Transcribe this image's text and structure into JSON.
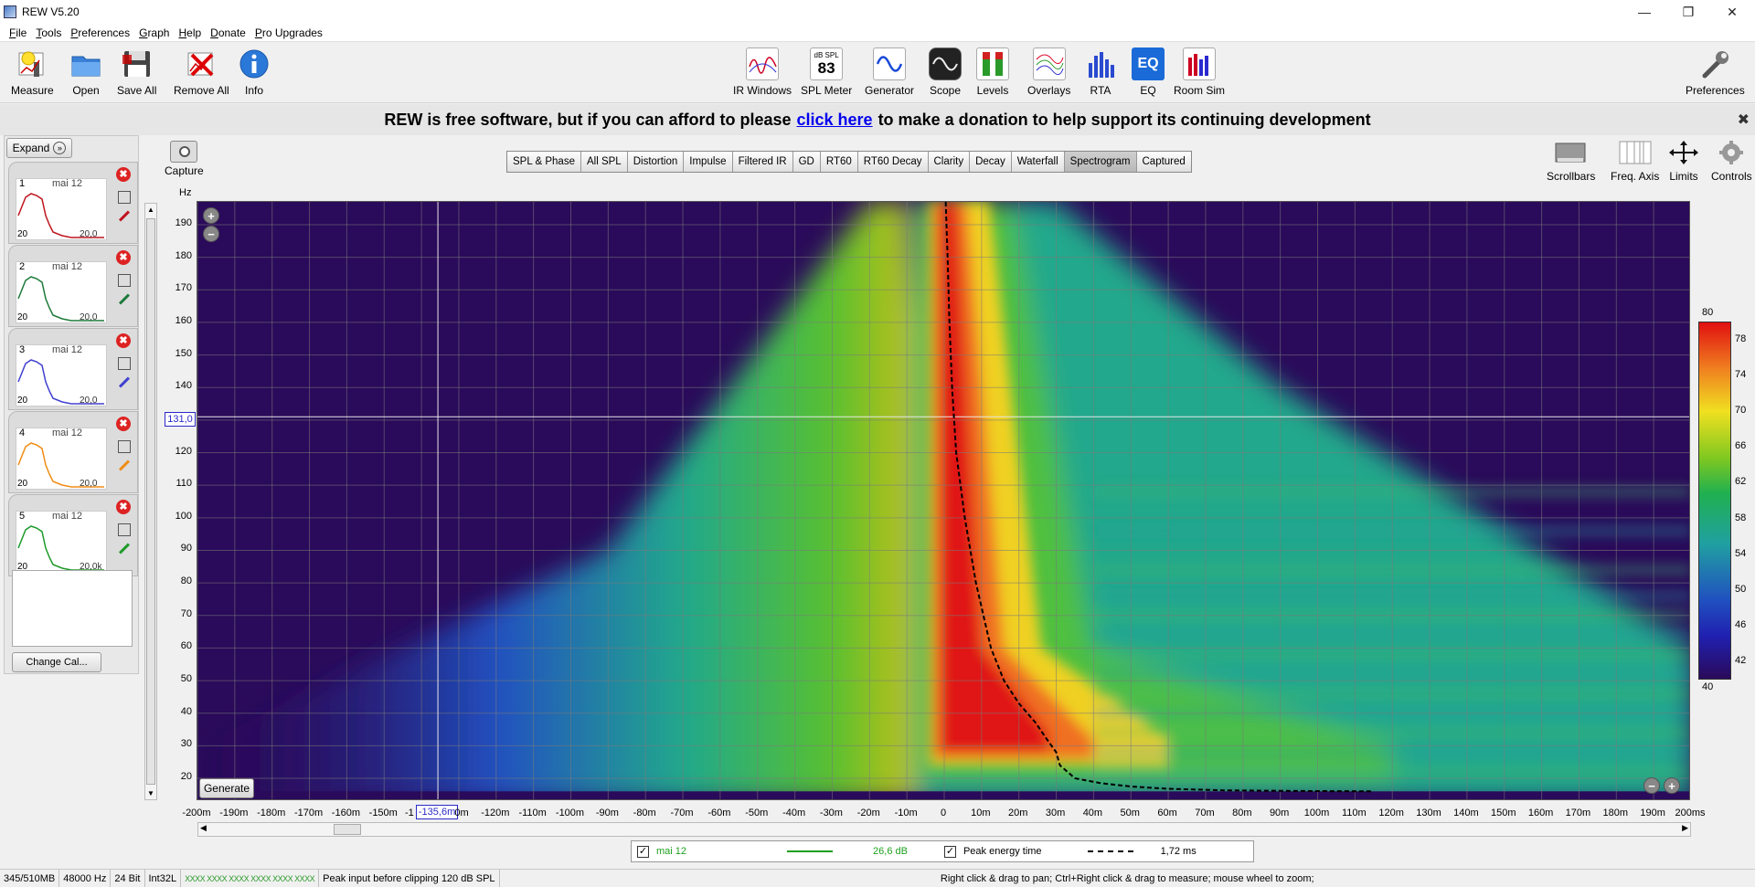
{
  "window": {
    "title": "REW V5.20",
    "minimize": "—",
    "restore": "❐",
    "close": "✕"
  },
  "menu": [
    "File",
    "Tools",
    "Preferences",
    "Graph",
    "Help",
    "Donate",
    "Pro Upgrades"
  ],
  "toolbar_left": [
    {
      "label": "Measure",
      "icon": "microphone-icon"
    },
    {
      "label": "Open",
      "icon": "folder-icon"
    },
    {
      "label": "Save All",
      "icon": "floppy-icon"
    },
    {
      "label": "Remove All",
      "icon": "remove-all-icon"
    },
    {
      "label": "Info",
      "icon": "info-icon"
    }
  ],
  "toolbar_center": [
    {
      "label": "IR Windows",
      "icon": "ir-windows-icon"
    },
    {
      "label": "SPL Meter",
      "icon": "spl-meter-icon",
      "top": "dB SPL",
      "value": "83"
    },
    {
      "label": "Generator",
      "icon": "generator-icon"
    },
    {
      "label": "Scope",
      "icon": "scope-icon"
    },
    {
      "label": "Levels",
      "icon": "levels-icon"
    },
    {
      "label": "Overlays",
      "icon": "overlays-icon"
    },
    {
      "label": "RTA",
      "icon": "rta-icon"
    },
    {
      "label": "EQ",
      "icon": "eq-icon"
    },
    {
      "label": "Room Sim",
      "icon": "room-sim-icon"
    }
  ],
  "toolbar_right": {
    "label": "Preferences",
    "icon": "wrench-icon"
  },
  "banner": {
    "before": "REW is free software, but if you can afford to please",
    "link": "click here",
    "after": "to make a donation to help support its continuing development",
    "close": "✖"
  },
  "left_panel": {
    "expand": "Expand",
    "change_cal": "Change Cal...",
    "measurements": [
      {
        "num": "1",
        "date": "mai 12",
        "low": "20",
        "high": "20,0",
        "color": "#c0141e"
      },
      {
        "num": "2",
        "date": "mai 12",
        "low": "20",
        "high": "20,0",
        "color": "#1e7a3c"
      },
      {
        "num": "3",
        "date": "mai 12",
        "low": "20",
        "high": "20,0",
        "color": "#4040d0"
      },
      {
        "num": "4",
        "date": "mai 12",
        "low": "20",
        "high": "20,0",
        "color": "#f08c14"
      },
      {
        "num": "5",
        "date": "mai 12",
        "low": "20",
        "high": "20,0k",
        "color": "#1e9a2a"
      }
    ]
  },
  "capture": {
    "label": "Capture",
    "icon": "camera-icon"
  },
  "graph_tabs": [
    "SPL & Phase",
    "All SPL",
    "Distortion",
    "Impulse",
    "Filtered IR",
    "GD",
    "RT60",
    "RT60 Decay",
    "Clarity",
    "Decay",
    "Waterfall",
    "Spectrogram",
    "Captured"
  ],
  "selected_tab": "Spectrogram",
  "right_tools": [
    {
      "label": "Scrollbars",
      "icon": "scrollbars-icon"
    },
    {
      "label": "Freq. Axis",
      "icon": "freq-axis-icon"
    },
    {
      "label": "Limits",
      "icon": "limits-icon"
    },
    {
      "label": "Controls",
      "icon": "gear-icon"
    }
  ],
  "chart_data": {
    "type": "heatmap",
    "title": "",
    "ylabel": "Hz",
    "xlabel": "",
    "x_unit": "ms",
    "xlim": [
      -200,
      200
    ],
    "ylim": [
      13,
      197
    ],
    "y_ticks": [
      20,
      30,
      40,
      50,
      60,
      70,
      80,
      90,
      100,
      110,
      120,
      130,
      140,
      150,
      160,
      170,
      180,
      190
    ],
    "x_ticks": [
      -200,
      -190,
      -180,
      -170,
      -160,
      -150,
      -140,
      -130,
      -120,
      -110,
      -100,
      -90,
      -80,
      -70,
      -60,
      -50,
      -40,
      -30,
      -20,
      -10,
      0,
      10,
      20,
      30,
      40,
      50,
      60,
      70,
      80,
      90,
      100,
      110,
      120,
      130,
      140,
      150,
      160,
      170,
      180,
      190,
      200
    ],
    "x_tick_labels": [
      "-200m",
      "-190m",
      "-180m",
      "-170m",
      "-160m",
      "-150m",
      "-1",
      "-135,6m",
      "0m",
      "-120m",
      "-110m",
      "-100m",
      "-90m",
      "-80m",
      "-70m",
      "-60m",
      "-50m",
      "-40m",
      "-30m",
      "-20m",
      "-10m",
      "0",
      "10m",
      "20m",
      "30m",
      "40m",
      "50m",
      "60m",
      "70m",
      "80m",
      "90m",
      "100m",
      "110m",
      "120m",
      "130m",
      "140m",
      "150m",
      "160m",
      "170m",
      "180m",
      "190m",
      "200ms"
    ],
    "colorbar": {
      "min": 40,
      "max": 80,
      "ticks": [
        42,
        46,
        50,
        54,
        58,
        62,
        66,
        70,
        74,
        78
      ]
    },
    "cursor": {
      "x_label": "-135,6m",
      "y_label": "131,0",
      "x": -135.6,
      "y": 131.0
    },
    "peak_energy_time": {
      "name": "Peak energy time",
      "x": [
        0.4,
        0.9,
        1.4,
        2.1,
        3.2,
        5.5,
        8.5,
        12.5,
        16,
        20,
        24.5,
        27.5,
        30,
        31,
        35,
        42,
        50,
        60,
        75,
        95,
        115
      ],
      "y": [
        197,
        180,
        160,
        140,
        120,
        100,
        80,
        60,
        50,
        43,
        37,
        32,
        28,
        24,
        20,
        18.5,
        17.5,
        16.8,
        16.3,
        16.1,
        16
      ]
    },
    "grid": true
  },
  "plot_controls": {
    "generate": "Generate",
    "zoom_in": "+",
    "zoom_out": "−"
  },
  "legend": {
    "items": [
      {
        "checked": "✓",
        "name": "mai 12",
        "value": "26,6 dB",
        "color": "#1ea01e"
      },
      {
        "checked": "✓",
        "name": "Peak energy time",
        "value": "1,72 ms",
        "color": "#000000"
      }
    ]
  },
  "status": {
    "memory": "345/510MB",
    "rate": "48000 Hz",
    "bits": "24 Bit",
    "format": "Int32L",
    "meters": "XXXX XXXX   XXXX XXXX   XXXX XXXX",
    "peak": "Peak input before clipping 120 dB SPL",
    "hint": "Right click & drag to pan; Ctrl+Right click & drag to measure; mouse wheel to zoom;"
  }
}
